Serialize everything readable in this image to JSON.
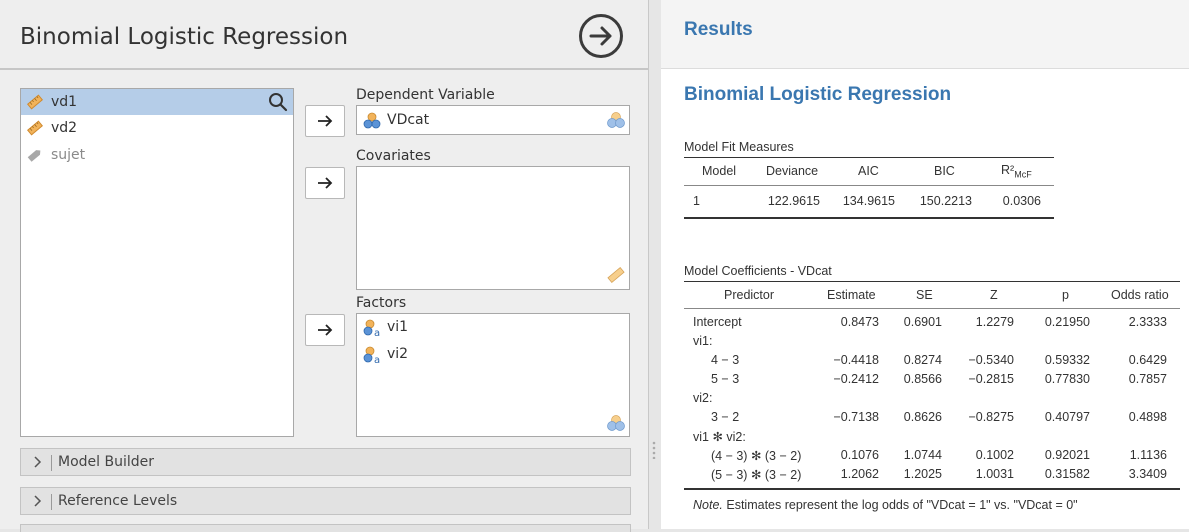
{
  "options": {
    "title": "Binomial Logistic Regression",
    "variables": [
      {
        "name": "vd1",
        "icon": "continuous-ruler-icon",
        "selected": true
      },
      {
        "name": "vd2",
        "icon": "continuous-ruler-icon",
        "selected": false
      },
      {
        "name": "sujet",
        "icon": "id-tag-icon",
        "selected": false
      }
    ],
    "dependent_label": "Dependent Variable",
    "dependent_value": "VDcat",
    "covariates_label": "Covariates",
    "factors_label": "Factors",
    "factors": [
      "vi1",
      "vi2"
    ],
    "sections": [
      "Model Builder",
      "Reference Levels"
    ]
  },
  "results": {
    "header": "Results",
    "analysis_title": "Binomial Logistic Regression",
    "fit": {
      "title": "Model Fit Measures",
      "headers": [
        "Model",
        "Deviance",
        "AIC",
        "BIC",
        "R²",
        "McF"
      ],
      "row": [
        "1",
        "122.9615",
        "134.9615",
        "150.2213",
        "0.0306"
      ]
    },
    "coef": {
      "title": "Model Coefficients - VDcat",
      "headers": [
        "Predictor",
        "Estimate",
        "SE",
        "Z",
        "p",
        "Odds ratio"
      ],
      "rows": [
        [
          "Intercept",
          "0.8473",
          "0.6901",
          "1.2279",
          "0.21950",
          "2.3333"
        ],
        [
          "vi1:",
          "",
          "",
          "",
          "",
          ""
        ],
        [
          "4 − 3",
          "−0.4418",
          "0.8274",
          "−0.5340",
          "0.59332",
          "0.6429"
        ],
        [
          "5 − 3",
          "−0.2412",
          "0.8566",
          "−0.2815",
          "0.77830",
          "0.7857"
        ],
        [
          "vi2:",
          "",
          "",
          "",
          "",
          ""
        ],
        [
          "3 − 2",
          "−0.7138",
          "0.8626",
          "−0.8275",
          "0.40797",
          "0.4898"
        ],
        [
          "vi1 ✻ vi2:",
          "",
          "",
          "",
          "",
          ""
        ],
        [
          "(4 − 3) ✻ (3 − 2)",
          "0.1076",
          "1.0744",
          "0.1002",
          "0.92021",
          "1.1136"
        ],
        [
          "(5 − 3) ✻ (3 − 2)",
          "1.2062",
          "1.2025",
          "1.0031",
          "0.31582",
          "3.3409"
        ]
      ],
      "note_prefix": "Note.",
      "note_text": " Estimates represent the log odds of \"VDcat = 1\" vs. \"VDcat = 0\""
    }
  },
  "colors": {
    "accent": "#3a77b0",
    "selection": "#b5cde8"
  }
}
